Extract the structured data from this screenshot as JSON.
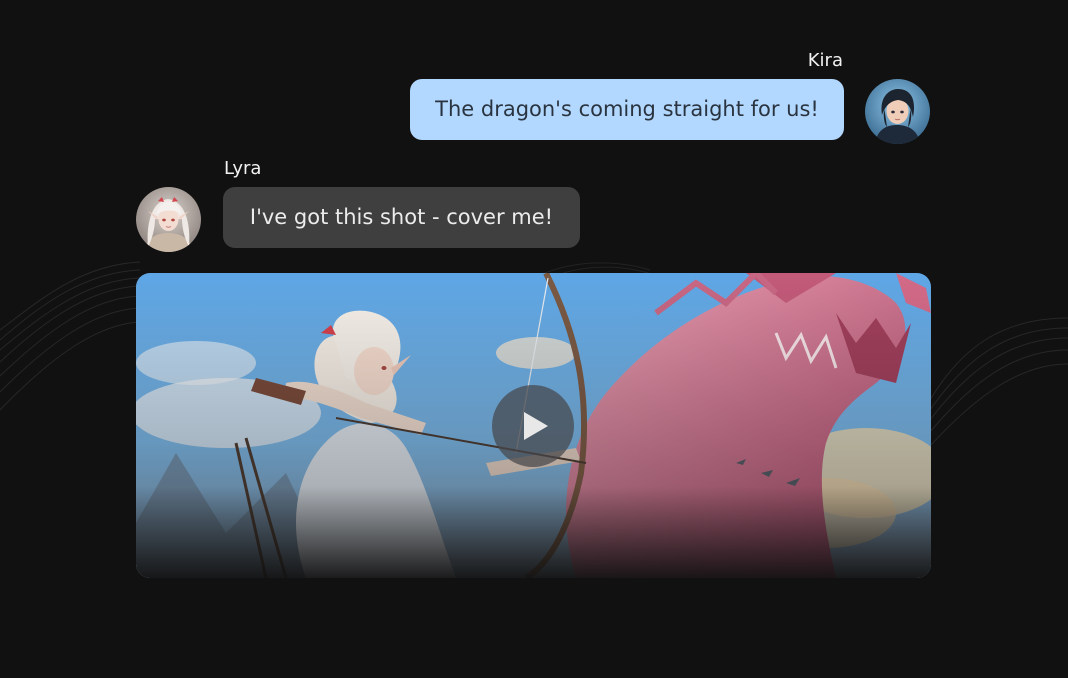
{
  "chat": {
    "messages": [
      {
        "sender": "Kira",
        "text": "The dragon's coming straight for us!",
        "side": "right",
        "avatar_icon": "kira-avatar",
        "bubble_color": "#b3d8ff"
      },
      {
        "sender": "Lyra",
        "text": "I've got this shot - cover me!",
        "side": "left",
        "avatar_icon": "lyra-avatar",
        "bubble_color": "#3f3f3f"
      }
    ],
    "attachment": {
      "type": "video",
      "play_icon": "play-icon"
    }
  },
  "theme": {
    "background": "#111111",
    "accent": "#b3d8ff"
  }
}
